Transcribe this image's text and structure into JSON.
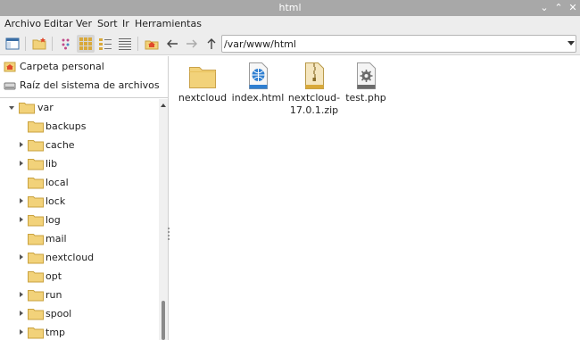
{
  "window": {
    "title": "html",
    "minimize_glyph": "⌄",
    "maximize_glyph": "⌃",
    "close_glyph": "✕"
  },
  "menu": [
    "Archivo",
    "Editar",
    "Ver",
    "Sort",
    "Ir",
    "Herramientas"
  ],
  "toolbar": {
    "path": "/var/www/html",
    "icons": [
      "new-window-icon",
      "new-folder-icon",
      "hidden-files-icon",
      "icon-view-icon",
      "thumbnail-view-icon",
      "compact-view-icon",
      "list-view-icon",
      "home-icon",
      "back-arrow-icon",
      "forward-arrow-icon",
      "up-arrow-icon"
    ]
  },
  "places": [
    {
      "label": "Carpeta personal",
      "icon": "home-folder-icon"
    },
    {
      "label": "Raíz del sistema de archivos",
      "icon": "drive-icon"
    }
  ],
  "tree": [
    {
      "label": "var",
      "expander": "down"
    },
    {
      "label": "backups",
      "expander": "none"
    },
    {
      "label": "cache",
      "expander": "right"
    },
    {
      "label": "lib",
      "expander": "right"
    },
    {
      "label": "local",
      "expander": "none"
    },
    {
      "label": "lock",
      "expander": "right"
    },
    {
      "label": "log",
      "expander": "right"
    },
    {
      "label": "mail",
      "expander": "none"
    },
    {
      "label": "nextcloud",
      "expander": "right"
    },
    {
      "label": "opt",
      "expander": "none"
    },
    {
      "label": "run",
      "expander": "right"
    },
    {
      "label": "spool",
      "expander": "right"
    },
    {
      "label": "tmp",
      "expander": "right"
    }
  ],
  "files": [
    {
      "name": "nextcloud",
      "icon": "folder-icon"
    },
    {
      "name": "index.html",
      "icon": "html-file-icon"
    },
    {
      "name": "nextcloud-17.0.1.zip",
      "icon": "zip-archive-icon"
    },
    {
      "name": "test.php",
      "icon": "php-file-icon"
    }
  ],
  "colors": {
    "titlebar": "#a8a8a8",
    "folder": "#f2d27a",
    "accent_home": "#e04a2b"
  }
}
